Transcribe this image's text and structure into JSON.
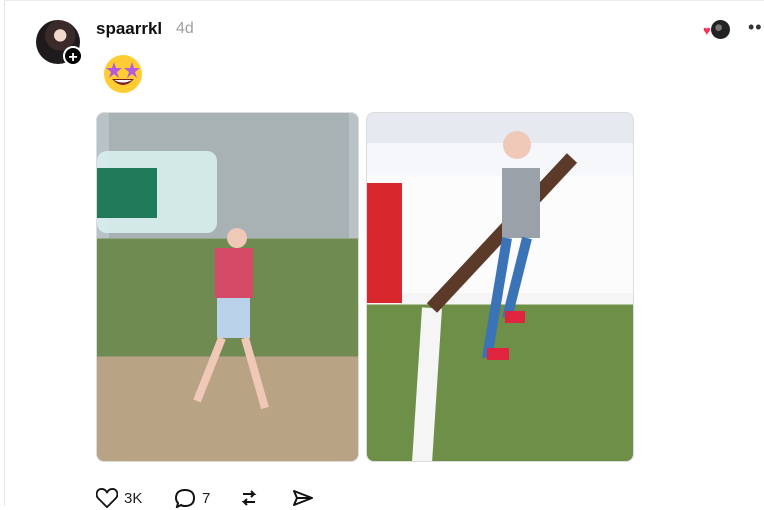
{
  "post": {
    "username": "spaarrkl",
    "timestamp": "4d",
    "emoji": "star-struck",
    "images": [
      {
        "alt": "Girl standing by a wall under a large bottle"
      },
      {
        "alt": "Girl sitting in a tree"
      }
    ],
    "actions": {
      "like_count": "3K",
      "reply_count": "7"
    }
  },
  "icons": {
    "avatar_plus": "plus-icon",
    "like": "heart-icon",
    "reply": "speech-bubble-icon",
    "repost": "repost-icon",
    "share": "send-icon",
    "more": "more-icon"
  },
  "colors": {
    "text": "#101010",
    "muted": "#a0a0a0",
    "heart": "#ff2d55",
    "emoji_face": "#ffcc33",
    "emoji_star": "#b45bdb"
  }
}
